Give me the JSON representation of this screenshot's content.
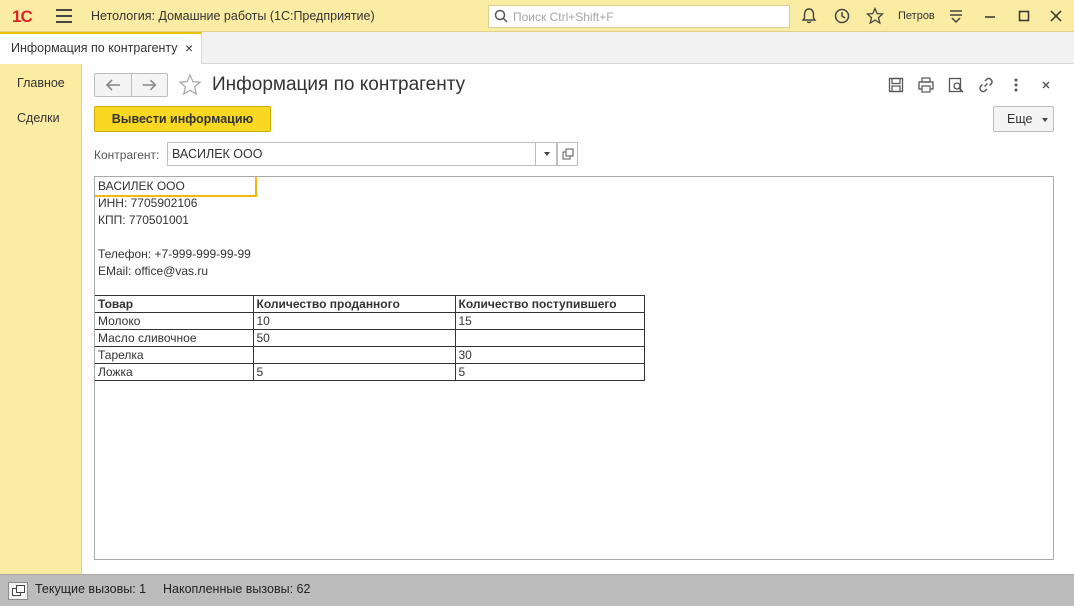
{
  "app": {
    "logo": "1С",
    "title": "Нетология: Домашние работы  (1С:Предприятие)",
    "search_placeholder": "Поиск Ctrl+Shift+F",
    "user": "Петров"
  },
  "tabs": [
    {
      "label": "Информация по контрагенту",
      "close": "×"
    }
  ],
  "sidebar": {
    "items": [
      {
        "label": "Главное"
      },
      {
        "label": "Сделки"
      }
    ]
  },
  "form": {
    "title": "Информация по контрагенту",
    "primary_button": "Вывести информацию",
    "more_button": "Еще",
    "field_label": "Контрагент:",
    "field_value": "ВАСИЛЕК ООО"
  },
  "report": {
    "name": "ВАСИЛЕК ООО",
    "inn": "ИНН: 7705902106",
    "kpp": "КПП: 770501001",
    "phone": "Телефон: +7-999-999-99-99",
    "email": "EMail: office@vas.ru",
    "table": {
      "headers": [
        "Товар",
        "Количество проданного",
        "Количество поступившего"
      ],
      "rows": [
        [
          "Молоко",
          "10",
          "15"
        ],
        [
          "Масло сливочное",
          "50",
          ""
        ],
        [
          "Тарелка",
          "",
          "30"
        ],
        [
          "Ложка",
          "5",
          "5"
        ]
      ]
    }
  },
  "status": {
    "current_calls": "Текущие вызовы: 1",
    "accumulated_calls": "Накопленные вызовы: 62"
  },
  "colors": {
    "panel_yellow": "#fbeca3",
    "button_yellow": "#f8d822",
    "selection_orange": "#f0b90c",
    "logo_red": "#d9262c"
  }
}
